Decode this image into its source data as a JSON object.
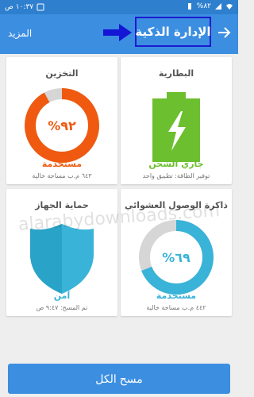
{
  "status_bar": {
    "time": "١٠:٣٧ ص",
    "battery_percent": "%٨٢",
    "icons": [
      "battery-icon",
      "signal-icon",
      "wifi-icon",
      "notification-icon"
    ]
  },
  "header": {
    "title": "الإدارة الذكية",
    "more_label": "المزيد",
    "back_icon": "arrow-right-icon",
    "annotation_arrow": "arrow-right-icon"
  },
  "cards": {
    "storage": {
      "title": "التخزين",
      "percent_label": "%٩٢",
      "used_fraction": 0.92,
      "status": "مستخدمة",
      "subtext": "٦٤٣ م.ب مساحة خالية",
      "color": "#ef5a10"
    },
    "battery": {
      "title": "البطارية",
      "status": "جاري الشحن",
      "subtext": "توفير الطاقة: تطبيق واحد",
      "color": "#6cbf2f"
    },
    "protection": {
      "title": "حماية الجهاز",
      "status": "آمن",
      "subtext": "تم المسح: ٩:٤٧ ص",
      "color": "#3ab3d8"
    },
    "memory": {
      "title": "ذاكرة الوصول العشوائي",
      "percent_label": "%٦٩",
      "used_fraction": 0.69,
      "status": "مستخدمة",
      "subtext": "٤٤٢ م.ب مساحة خالية",
      "color": "#3ab3d8"
    }
  },
  "action_button": {
    "label": "مسح الكل"
  },
  "watermark": "alarabydownloads.com",
  "colors": {
    "primary": "#3b8ee0",
    "storage": "#ef5a10",
    "battery": "#6cbf2f",
    "protection": "#3ab3d8",
    "track": "#d6d6d6"
  }
}
